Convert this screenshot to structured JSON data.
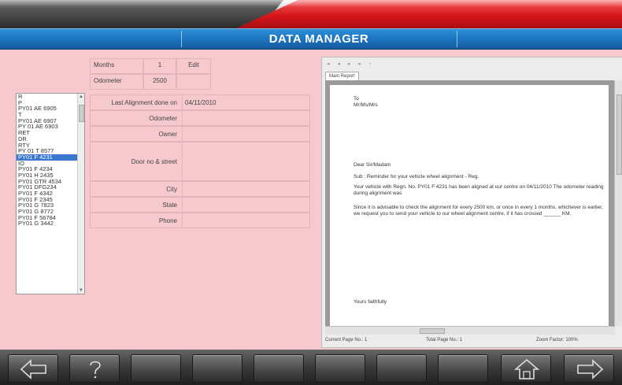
{
  "header": {
    "title": "DATA MANAGER"
  },
  "top_table": {
    "months_label": "Months",
    "months_value": "1",
    "edit_label": "Edit",
    "odometer_label": "Odometer",
    "odometer_value": "2500"
  },
  "vehicle_list": {
    "items": [
      "R",
      "P",
      "PY01 AE 6905",
      "T",
      "PY01 AE 6907",
      "PY 01 AE 6903",
      "RET",
      "DR",
      "RTY",
      "PY 01 T 8577",
      "PY01 F 4231",
      "IO",
      "PY01 F 4234",
      "PY01 H 2435",
      "PY01 GTR 4534",
      "PY01 DFG234",
      "PY01 F 4342",
      "PY01 F 2345",
      "PY01 G 7823",
      "PY01 G 8772",
      "PY01 F 56784",
      "PY01 G 3442"
    ],
    "selected_index": 10
  },
  "details": {
    "rows": [
      {
        "label": "Last Alignment done on",
        "value": "04/11/2010"
      },
      {
        "label": "Odometer",
        "value": ""
      },
      {
        "label": "Owner",
        "value": ""
      },
      {
        "label": "Door no & street",
        "value": ""
      },
      {
        "label": "City",
        "value": ""
      },
      {
        "label": "State",
        "value": ""
      },
      {
        "label": "Phone",
        "value": ""
      }
    ]
  },
  "report": {
    "tab_label": "Main Report",
    "to_line": "To",
    "to_name": "Mr/Ms/Mrs",
    "salutation": "Dear Sir/Madam",
    "subject": "Sub : Reminder for your vehicle wheel alignment - Reg.",
    "para1": "Your vehicle with Regn. No. PY01 F 4231 has been aligned at our centre on 04/11/2010 The odometer reading during alignment was",
    "para2": "Since it is advisable to check the alignment for every 2500 km, or once in every 1 months, whichever is earlier, we request you to send your vehicle to our wheel alignment centre, if it has crossed ______ KM.",
    "closing": "Yours faithfully",
    "current_page": "Current Page No.: 1",
    "total_page": "Total Page No.: 1",
    "zoom": "Zoom Factor: 100%"
  },
  "toolbar": {
    "buttons": [
      "back-arrow-icon",
      "help-icon",
      "blank",
      "blank",
      "blank",
      "blank",
      "blank",
      "blank",
      "home-icon",
      "forward-arrow-icon"
    ]
  },
  "colors": {
    "background": "#f6c9cf",
    "title_blue": "#1c74c1",
    "header_red": "#d8161b",
    "selection": "#3a78d0"
  }
}
